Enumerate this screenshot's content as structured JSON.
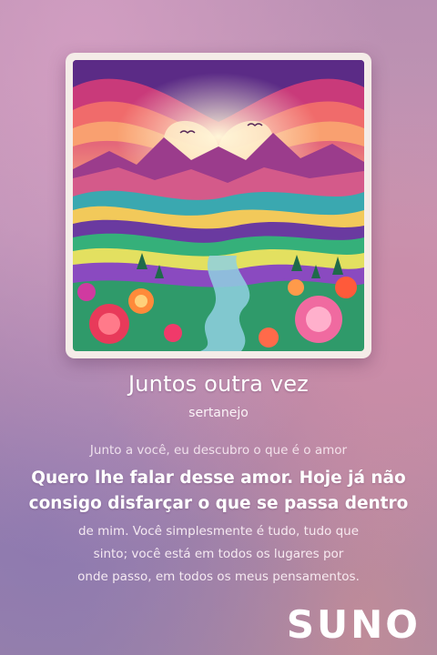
{
  "cover": {
    "description_icon": "album-cover-art"
  },
  "song": {
    "title": "Juntos outra vez",
    "genre": "sertanejo"
  },
  "lyrics": {
    "previous": "Junto a você, eu descubro o que é o amor",
    "current": [
      "Quero lhe falar desse amor. Hoje já não",
      "consigo disfarçar o que se passa dentro"
    ],
    "next": [
      "de mim. Você simplesmente é tudo, tudo que",
      "sinto; você está em todos os lugares por",
      "onde passo, em todos os meus pensamentos."
    ]
  },
  "brand": {
    "logo_text": "SUNO"
  },
  "colors": {
    "text": "#ffffff",
    "background_top": "#b98fb2",
    "background_bottom": "#a089a8"
  }
}
